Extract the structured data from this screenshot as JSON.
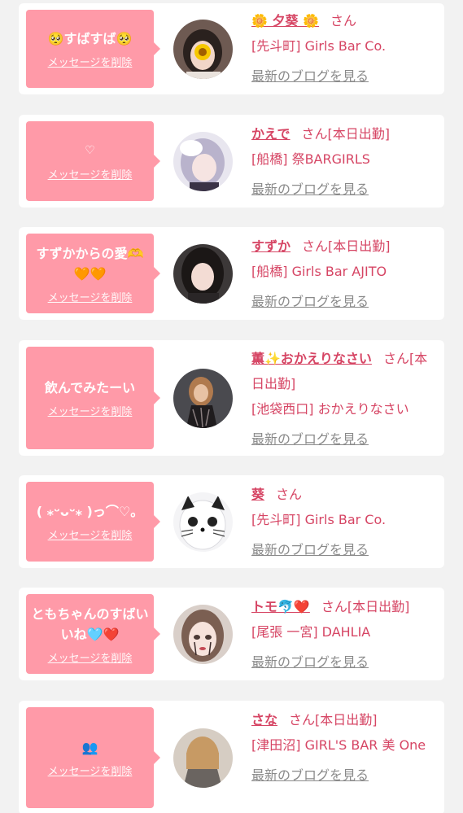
{
  "common": {
    "delete_label": "メッセージを削除",
    "blog_label": "最新のブログを見る",
    "san": "さん"
  },
  "colors": {
    "page_bg": "#f2f2f2",
    "bubble": "#ff9aa8",
    "accent_text": "#d64564",
    "link_gray": "#8a8a8a"
  },
  "cards": [
    {
      "message": "🥺すばすば🥺",
      "name": "🌼 夕葵 🌼",
      "status": "",
      "shop": "[先斗町] Girls Bar Co.",
      "avatar_icon": "profile-photo-girl-with-sunflower"
    },
    {
      "message": "♡",
      "name": "かえで",
      "status": "[本日出勤]",
      "shop": "[船橋] 祭BARGIRLS",
      "avatar_icon": "profile-photo-girl-silver-hair"
    },
    {
      "message": "すずかからの愛🫶🧡🧡",
      "name": "すずか",
      "status": "[本日出勤]",
      "shop": "[船橋] Girls Bar AJITO",
      "avatar_icon": "profile-photo-girl-dark-hair"
    },
    {
      "message": "飲んでみたーい",
      "name": "薫✨おかえりなさい",
      "status": "[本日出勤]",
      "shop": "[池袋西口] おかえりなさい",
      "avatar_icon": "profile-photo-woman-lace"
    },
    {
      "message": "( ⁎ᵕᴗᵕ⁎ )っ⌒♡。",
      "name": "葵",
      "status": "",
      "shop": "[先斗町] Girls Bar Co.",
      "avatar_icon": "profile-photo-cat-filter"
    },
    {
      "message": "ともちゃんのすばいいね🩵❤️",
      "name": "トモ🐬❤️",
      "status": "[本日出勤]",
      "shop": "[尾張 一宮] DAHLIA",
      "avatar_icon": "profile-photo-doll-face"
    },
    {
      "message": "👥",
      "name": "さな",
      "status": "[本日出勤]",
      "shop": "[津田沼] GIRL'S BAR 美 One",
      "avatar_icon": "profile-photo-blonde-back"
    }
  ]
}
